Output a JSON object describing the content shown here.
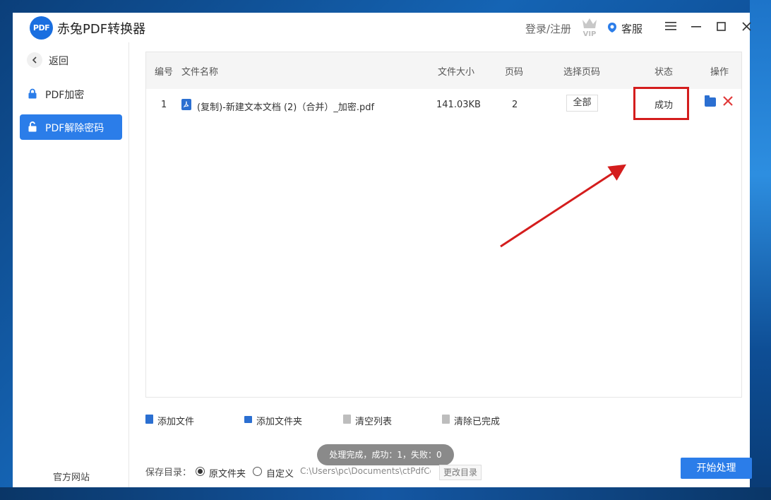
{
  "app": {
    "title": "赤兔PDF转换器",
    "logo_text": "PDF"
  },
  "header": {
    "login_label": "登录/注册",
    "vip_badge": "VIP",
    "service_label": "客服",
    "menu_icon": "hamburger-icon",
    "minimize_icon": "minimize-icon",
    "maximize_icon": "maximize-icon",
    "close_icon": "close-icon"
  },
  "sidebar": {
    "back_label": "返回",
    "items": [
      {
        "label": "PDF加密",
        "icon": "lock-icon",
        "active": false
      },
      {
        "label": "PDF解除密码",
        "icon": "unlock-icon",
        "active": true
      }
    ],
    "footer_link": "官方网站"
  },
  "table": {
    "columns": [
      "编号",
      "文件名称",
      "文件大小",
      "页码",
      "选择页码",
      "状态",
      "操作"
    ],
    "rows": [
      {
        "index": "1",
        "filename": "(复制)-新建文本文档 (2)（合并）_加密.pdf",
        "size": "141.03KB",
        "pages": "2",
        "page_select": "全部",
        "status": "成功"
      }
    ]
  },
  "toolbar": {
    "add_file": "添加文件",
    "add_folder": "添加文件夹",
    "clear_list": "清空列表",
    "clear_done": "清除已完成"
  },
  "toast": "处理完成，成功：1，失败：0",
  "save": {
    "label": "保存目录：",
    "option_original": "原文件夹",
    "option_custom": "自定义",
    "selected": "原文件夹",
    "path": "C:\\Users\\pc\\Documents\\ctPdfCo",
    "change_dir": "更改目录"
  },
  "start_button": "开始处理",
  "colors": {
    "accent": "#2b7de9",
    "annotation": "#d41d1d",
    "delete": "#e03a3a"
  }
}
